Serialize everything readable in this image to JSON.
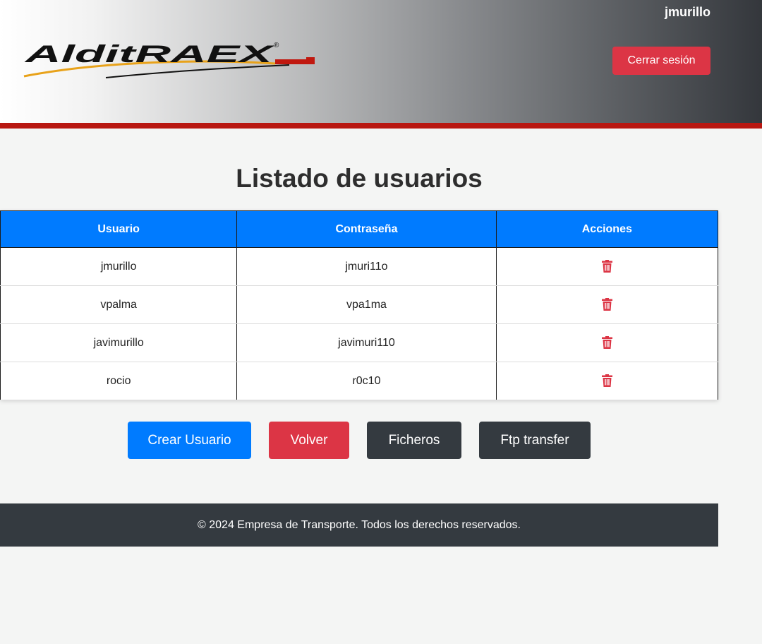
{
  "header": {
    "username": "jmurillo",
    "logout_label": "Cerrar sesión",
    "logo_text": "AlditRAEX",
    "logo_mark": "®"
  },
  "page": {
    "title": "Listado de usuarios"
  },
  "table": {
    "headers": [
      "Usuario",
      "Contraseña",
      "Acciones"
    ],
    "rows": [
      {
        "usuario": "jmurillo",
        "contrasena": "jmuri11o",
        "action_icon": "trash-icon"
      },
      {
        "usuario": "vpalma",
        "contrasena": "vpa1ma",
        "action_icon": "trash-icon"
      },
      {
        "usuario": "javimurillo",
        "contrasena": "javimuri110",
        "action_icon": "trash-icon"
      },
      {
        "usuario": "rocio",
        "contrasena": "r0c10",
        "action_icon": "trash-icon"
      }
    ]
  },
  "actions": {
    "create_user": "Crear Usuario",
    "back": "Volver",
    "files": "Ficheros",
    "ftp": "Ftp transfer"
  },
  "footer": {
    "text": "© 2024 Empresa de Transporte. Todos los derechos reservados."
  },
  "colors": {
    "primary": "#007bff",
    "danger": "#dc3545",
    "dark": "#343a40",
    "stripe": "#b81711"
  }
}
